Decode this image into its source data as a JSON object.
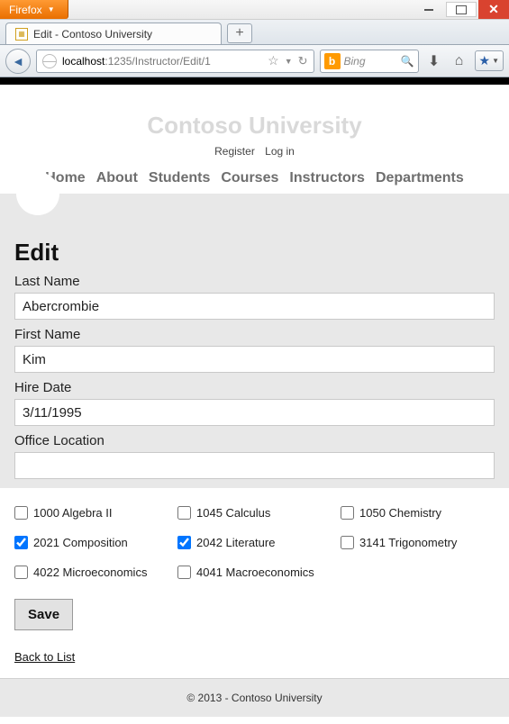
{
  "browser": {
    "menu_label": "Firefox",
    "tab_title": "Edit - Contoso University",
    "url_host": "localhost",
    "url_path": ":1235/Instructor/Edit/1",
    "search_placeholder": "Bing"
  },
  "site": {
    "title": "Contoso University",
    "account_links": [
      "Register",
      "Log in"
    ],
    "nav": [
      "Home",
      "About",
      "Students",
      "Courses",
      "Instructors",
      "Departments"
    ],
    "footer": "© 2013 - Contoso University"
  },
  "page": {
    "heading": "Edit",
    "fields": {
      "last_name_label": "Last Name",
      "last_name_value": "Abercrombie",
      "first_name_label": "First Name",
      "first_name_value": "Kim",
      "hire_date_label": "Hire Date",
      "hire_date_value": "3/11/1995",
      "office_label": "Office Location",
      "office_value": ""
    },
    "courses": [
      {
        "label": "1000 Algebra II",
        "checked": false
      },
      {
        "label": "1045 Calculus",
        "checked": false
      },
      {
        "label": "1050 Chemistry",
        "checked": false
      },
      {
        "label": "2021 Composition",
        "checked": true
      },
      {
        "label": "2042 Literature",
        "checked": true
      },
      {
        "label": "3141 Trigonometry",
        "checked": false
      },
      {
        "label": "4022 Microeconomics",
        "checked": false
      },
      {
        "label": "4041 Macroeconomics",
        "checked": false
      }
    ],
    "save_label": "Save",
    "back_label": "Back to List"
  }
}
